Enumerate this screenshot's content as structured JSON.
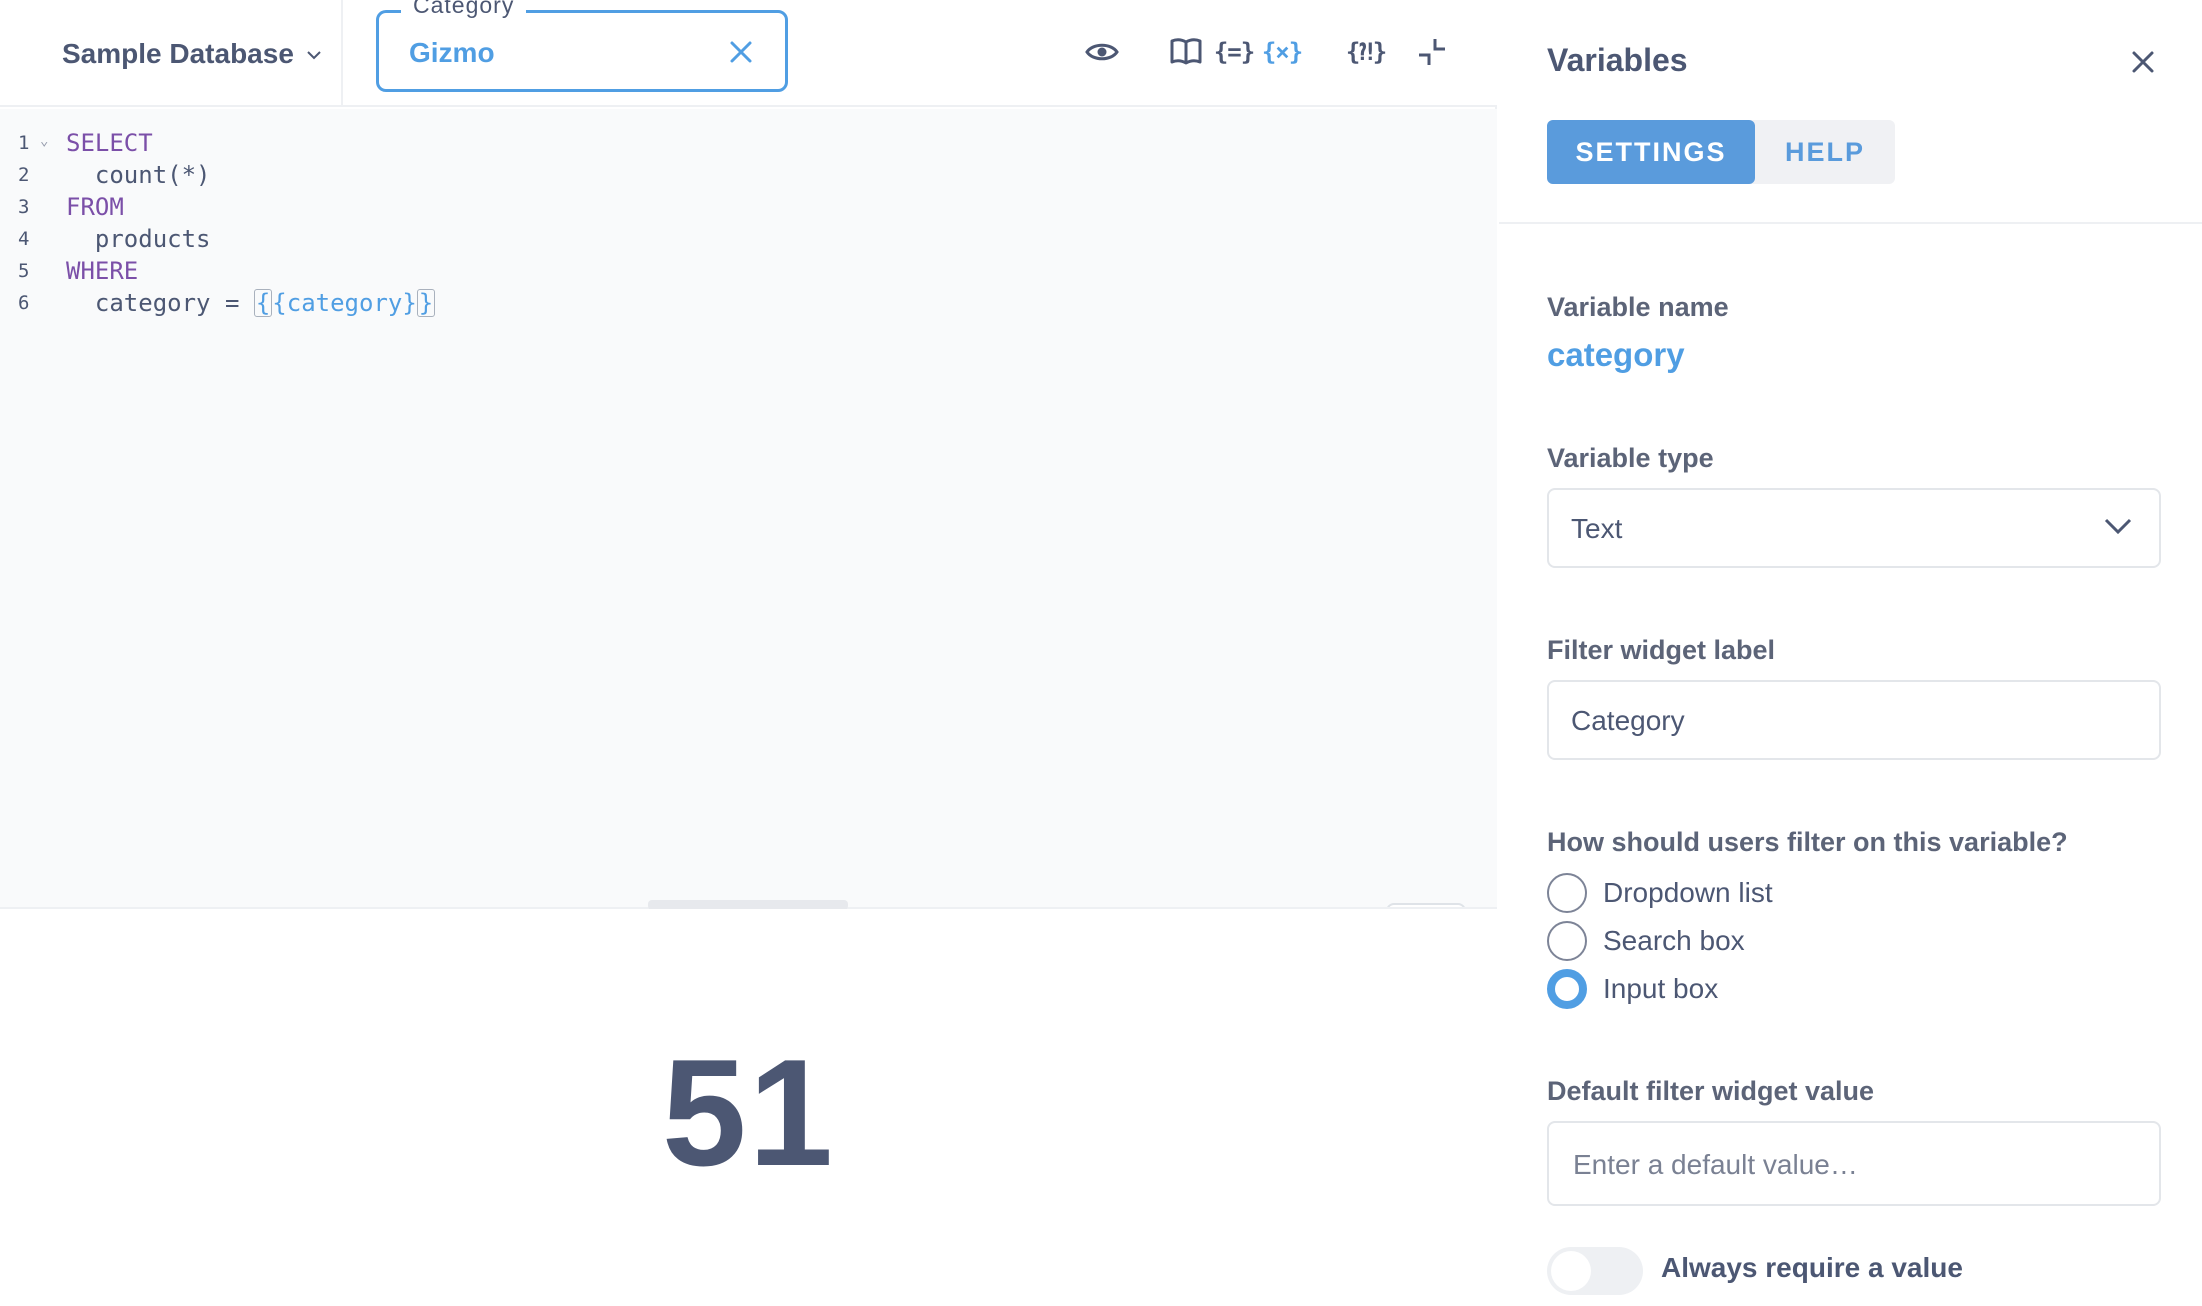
{
  "topbar": {
    "database_label": "Sample Database",
    "category_widget": {
      "legend": "Category",
      "value": "Gizmo"
    },
    "icons": [
      "eye-icon",
      "book-icon",
      "snippet-icon",
      "variable-icon",
      "snippet-folder-icon",
      "minimize-icon"
    ],
    "snippet_glyph": "{=}",
    "variable_glyph": "{×}",
    "snippet_folder_glyph": "{⁈}"
  },
  "editor": {
    "lines": [
      {
        "num": "1",
        "text": "SELECT"
      },
      {
        "num": "2",
        "text": "  count(*)"
      },
      {
        "num": "3",
        "text": "FROM"
      },
      {
        "num": "4",
        "text": "  products"
      },
      {
        "num": "5",
        "text": "WHERE"
      },
      {
        "num": "6",
        "text": "  category = "
      }
    ],
    "line6_tag": "{{category}}",
    "line6_tag_inner": "{category}"
  },
  "result": {
    "value": "51"
  },
  "panel": {
    "title": "Variables",
    "tabs": [
      {
        "label": "SETTINGS",
        "active": true
      },
      {
        "label": "HELP",
        "active": false
      }
    ],
    "variable_name_label": "Variable name",
    "variable_name_value": "category",
    "variable_type_label": "Variable type",
    "variable_type_value": "Text",
    "filter_label_label": "Filter widget label",
    "filter_label_value": "Category",
    "filter_mode_question": "How should users filter on this variable?",
    "filter_mode_options": [
      {
        "label": "Dropdown list",
        "checked": false
      },
      {
        "label": "Search box",
        "checked": false
      },
      {
        "label": "Input box",
        "checked": true
      }
    ],
    "default_label": "Default filter widget value",
    "default_placeholder": "Enter a default value…",
    "require_toggle_label": "Always require a value",
    "require_toggle_on": false
  },
  "colors": {
    "accent": "#509ee3",
    "text": "#4c5773",
    "keyword": "#7b4fa8",
    "editor_bg": "#f9fafb"
  }
}
